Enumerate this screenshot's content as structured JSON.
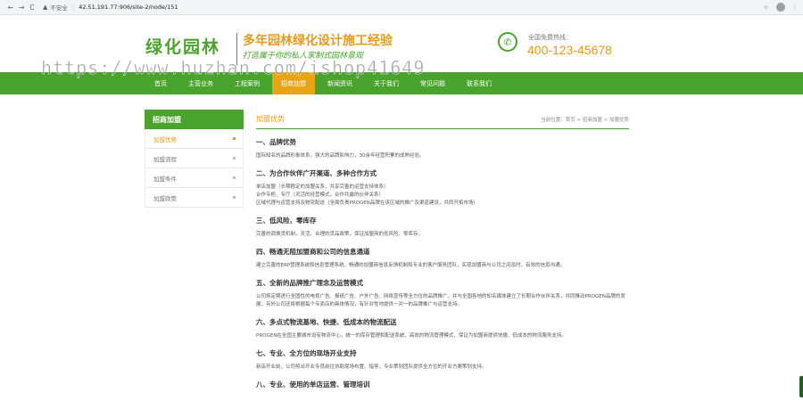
{
  "browser": {
    "back": "←",
    "forward": "→",
    "reload": "C",
    "warning_icon": "▲",
    "insecure_label": "不安全",
    "separator": "|",
    "url": "42.51.191.77:906/site-2/node/151",
    "star_icon": "☆",
    "menu_icon": "⋮"
  },
  "header": {
    "logo": "绿化园林",
    "slogan_main": "多年园林绿化设计施工经验",
    "slogan_sub": "打造属于你的私人家制式园林景观",
    "phone_icon": "✆",
    "phone_label": "全国免费热线：",
    "phone_number": "400-123-45678",
    "watermark": "https://www.huzhan.com/ishop41649"
  },
  "nav": {
    "items": [
      {
        "label": "首页"
      },
      {
        "label": "主营业务"
      },
      {
        "label": "工程案例"
      },
      {
        "label": "招商加盟"
      },
      {
        "label": "新闻资讯"
      },
      {
        "label": "关于我们"
      },
      {
        "label": "常见问题"
      },
      {
        "label": "联系我们"
      }
    ],
    "active_index": 3
  },
  "sidebar": {
    "title": "招商加盟",
    "items": [
      {
        "label": "加盟优势"
      },
      {
        "label": "加盟流程"
      },
      {
        "label": "加盟条件"
      },
      {
        "label": "加盟政策"
      }
    ]
  },
  "main": {
    "title": "加盟优势",
    "breadcrumb": "当前位置：首页 > 招商加盟 > 加盟优势",
    "sections": [
      {
        "title": "一、品牌优势",
        "lines": [
          "国际知名的品牌形象体系，强大的品牌影响力，30余年经营积累的成熟经验。"
        ]
      },
      {
        "title": "二、为合作伙伴广开渠道、多种合作方式",
        "lines": [
          "单店加盟（长期稳定的加盟关系，共享完善的运营支持体系）",
          "合作专柜、专厅（灵活的经营模式，合作共赢的伙伴关系）",
          "区域代理与运营支持及物流配送（全面负责PROGEN品牌在该区域的推广及渠道建设，共同开拓市场）"
        ]
      },
      {
        "title": "三、低风险，零库存",
        "lines": [
          "完善的调换货机制，灵活、合理的货品政策，保证加盟商的低风险、零库存。"
        ]
      },
      {
        "title": "四、畅通无阻加盟商和公司的信息通道",
        "lines": [
          "建立完善的ERP管理系统和信息管理系统，畅通的加盟商信息反馈机制和专业的客户服务团队，实现加盟商与公司之间及时、有效的信息沟通。"
        ]
      },
      {
        "title": "五、全新的品牌推广理念及运营模式",
        "lines": [
          "公司将定期进行全国性的电视广告、报纸广告、户外广告、网络宣传等全方位的品牌推广，并与全国各地的知名媒体建立了长期合作伙伴关系，共同推动PROGEN品牌的发展；另外公司还将根据每个专卖店的具体情况，有针对性地提供一对一的品牌推广与运营支持。"
        ]
      },
      {
        "title": "六、多点式物流基地、快捷、低成本的物流配送",
        "lines": [
          "PROGEN在全国主要城市设有物流中心，统一的库存管理和配送系统，高效的物流管理模式，保证为加盟商提供快捷、低成本的物流服务支持。"
        ]
      },
      {
        "title": "七、专业、全方位的现场开业支持",
        "lines": [
          "新店开业前，公司将派开业专员前往协助现场布置、指导，专业策划团队提供全方位的开业方案策划支持。"
        ]
      },
      {
        "title": "八、专业、使用的单店运营、管理培训",
        "lines": []
      }
    ]
  },
  "colors": {
    "brand_green": "#4aa32c",
    "accent_orange": "#e69a1c",
    "active_nav": "#e8a417"
  }
}
